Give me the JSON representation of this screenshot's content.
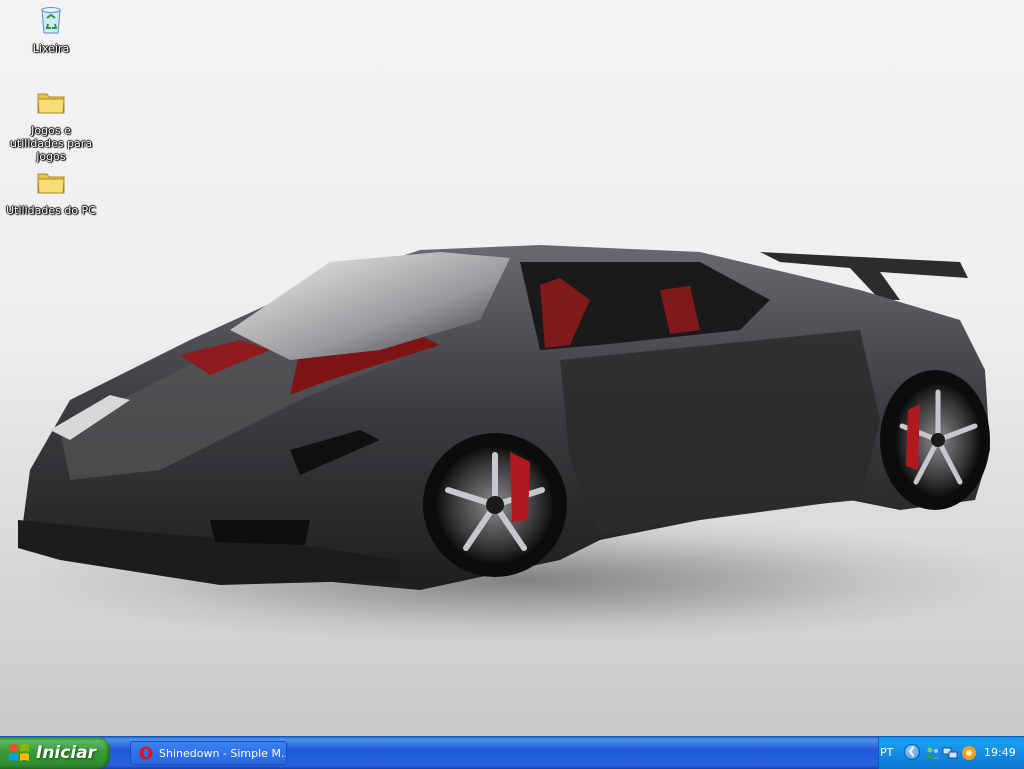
{
  "desktop": {
    "icons": [
      {
        "label": "Lixeira",
        "icon": "recycle-bin-icon"
      },
      {
        "label": "Jogos e utilidades para jogos",
        "icon": "folder-icon"
      },
      {
        "label": "Utilidades do PC",
        "icon": "folder-icon"
      }
    ]
  },
  "taskbar": {
    "start_label": "Iniciar",
    "task_items": [
      {
        "label": "Shinedown - Simple M...",
        "icon": "opera-browser-icon"
      }
    ],
    "tray": {
      "language": "PT",
      "clock": "19:49"
    }
  },
  "colors": {
    "taskbar_blue": "#2157d7",
    "start_green": "#379c37",
    "tray_blue": "#1287e1"
  }
}
